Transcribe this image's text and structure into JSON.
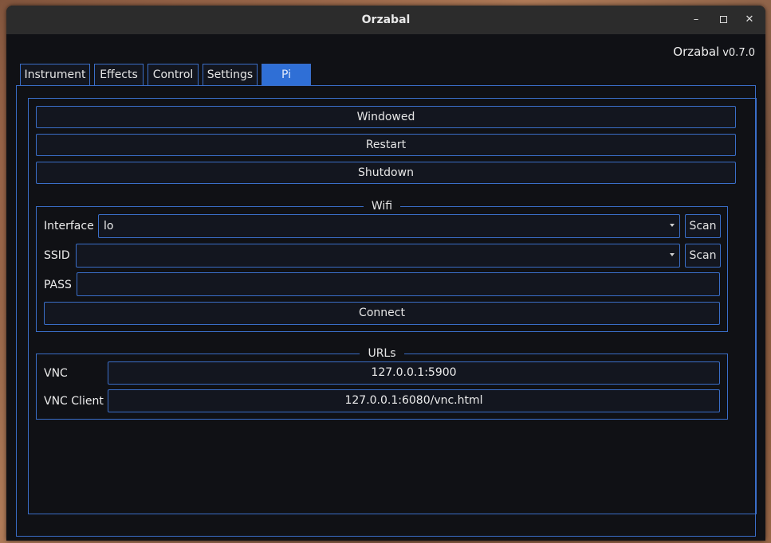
{
  "window": {
    "title": "Orzabal"
  },
  "header": {
    "app_name": "Orzabal",
    "version": "v0.7.0"
  },
  "tabs": [
    {
      "label": "Instrument"
    },
    {
      "label": "Effects"
    },
    {
      "label": "Control"
    },
    {
      "label": "Settings"
    },
    {
      "label": "Pi"
    }
  ],
  "active_tab": "Pi",
  "actions": {
    "windowed_label": "Windowed",
    "restart_label": "Restart",
    "shutdown_label": "Shutdown"
  },
  "wifi": {
    "title": "Wifi",
    "interface_label": "Interface",
    "interface_value": "lo",
    "ssid_label": "SSID",
    "ssid_value": "",
    "pass_label": "PASS",
    "pass_value": "",
    "scan_label": "Scan",
    "connect_label": "Connect"
  },
  "urls": {
    "title": "URLs",
    "vnc_label": "VNC",
    "vnc_value": "127.0.0.1:5900",
    "vnc_client_label": "VNC Client",
    "vnc_client_value": "127.0.0.1:6080/vnc.html"
  },
  "colors": {
    "accent": "#3a6ec8",
    "active_tab": "#2f6fd6",
    "background": "#101115",
    "titlebar": "#2c2c2c"
  },
  "icons": {
    "minimize": "minimize-icon",
    "maximize": "maximize-icon",
    "close": "close-icon",
    "dropdown": "chevron-down-icon"
  }
}
